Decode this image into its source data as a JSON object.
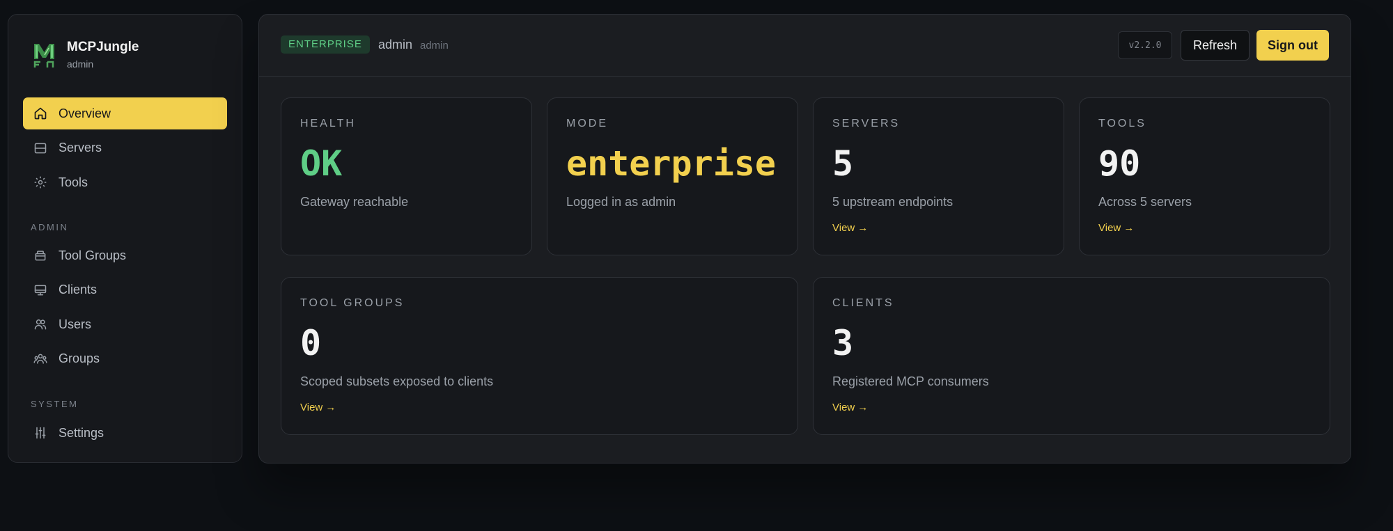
{
  "brand": {
    "name": "MCPJungle",
    "role": "admin"
  },
  "sidebar": {
    "items": [
      {
        "label": "Overview",
        "icon": "home-icon",
        "active": true
      },
      {
        "label": "Servers",
        "icon": "server-icon"
      },
      {
        "label": "Tools",
        "icon": "gear-icon"
      }
    ],
    "admin_label": "ADMIN",
    "admin_items": [
      {
        "label": "Tool Groups",
        "icon": "package-icon"
      },
      {
        "label": "Clients",
        "icon": "monitor-icon"
      },
      {
        "label": "Users",
        "icon": "users-icon"
      },
      {
        "label": "Groups",
        "icon": "group-icon"
      }
    ],
    "system_label": "SYSTEM",
    "system_items": [
      {
        "label": "Settings",
        "icon": "sliders-icon"
      }
    ]
  },
  "header": {
    "badge": "ENTERPRISE",
    "user_name": "admin",
    "user_role": "admin",
    "version": "v2.2.0",
    "refresh_label": "Refresh",
    "signout_label": "Sign out"
  },
  "cards": {
    "health": {
      "label": "HEALTH",
      "value": "OK",
      "desc": "Gateway reachable"
    },
    "mode": {
      "label": "MODE",
      "value": "enterprise",
      "desc": "Logged in as admin"
    },
    "servers": {
      "label": "SERVERS",
      "value": "5",
      "desc": "5 upstream endpoints",
      "link": "View →"
    },
    "tools": {
      "label": "TOOLS",
      "value": "90",
      "desc": "Across 5 servers",
      "link": "View →"
    },
    "tool_groups": {
      "label": "TOOL GROUPS",
      "value": "0",
      "desc": "Scoped subsets exposed to clients",
      "link": "View →"
    },
    "clients": {
      "label": "CLIENTS",
      "value": "3",
      "desc": "Registered MCP consumers",
      "link": "View →"
    }
  },
  "colors": {
    "accent": "#f2d04e",
    "ok": "#5fce86",
    "background": "#0d1014"
  }
}
